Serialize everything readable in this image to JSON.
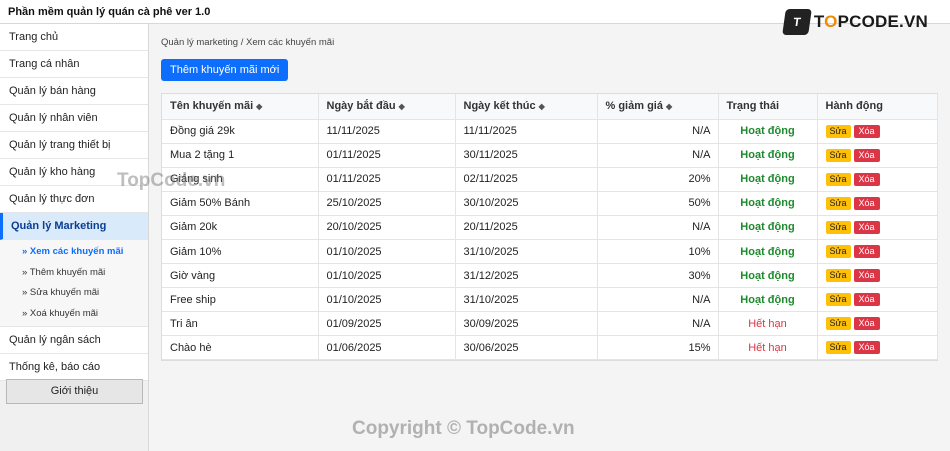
{
  "app": {
    "title": "Phần mềm quản lý quán cà phê ver 1.0"
  },
  "logo": {
    "mark": "T",
    "brand_pre": "T",
    "brand_o": "O",
    "brand_post": "PCODE.VN"
  },
  "sidebar": {
    "items_top": [
      {
        "label": "Trang chủ"
      },
      {
        "label": "Trang cá nhân"
      },
      {
        "label": "Quản lý bán hàng"
      },
      {
        "label": "Quản lý nhân viên"
      },
      {
        "label": "Quản lý trang thiết bị"
      },
      {
        "label": "Quản lý kho hàng"
      },
      {
        "label": "Quản lý thực đơn"
      }
    ],
    "active": {
      "label": "Quản lý Marketing"
    },
    "subitems": [
      {
        "label": "» Xem các khuyến mãi"
      },
      {
        "label": "» Thêm khuyến mãi"
      },
      {
        "label": "» Sửa khuyến mãi"
      },
      {
        "label": "» Xoá khuyến mãi"
      }
    ],
    "items_bottom": [
      {
        "label": "Quản lý ngân sách"
      },
      {
        "label": "Thống kê, báo cáo"
      }
    ],
    "intro_button": "Giới thiệu"
  },
  "main": {
    "breadcrumb": "Quản lý marketing / Xem các khuyến mãi",
    "add_button": "Thêm khuyến mãi mới",
    "sort_icon": "◆",
    "columns": [
      "Tên khuyến mãi",
      "Ngày bắt đầu",
      "Ngày kết thúc",
      "% giảm giá",
      "Trạng thái",
      "Hành động"
    ],
    "edit_label": "Sửa",
    "delete_label": "Xóa",
    "rows": [
      {
        "name": "Đồng giá 29k",
        "start": "11/11/2025",
        "end": "11/11/2025",
        "discount": "N/A",
        "status": "Hoạt động"
      },
      {
        "name": "Mua 2 tặng 1",
        "start": "01/11/2025",
        "end": "30/11/2025",
        "discount": "N/A",
        "status": "Hoạt động"
      },
      {
        "name": "Giáng sinh",
        "start": "01/11/2025",
        "end": "02/11/2025",
        "discount": "20%",
        "status": "Hoạt động"
      },
      {
        "name": "Giảm 50% Bánh",
        "start": "25/10/2025",
        "end": "30/10/2025",
        "discount": "50%",
        "status": "Hoạt động"
      },
      {
        "name": "Giảm 20k",
        "start": "20/10/2025",
        "end": "20/11/2025",
        "discount": "N/A",
        "status": "Hoạt động"
      },
      {
        "name": "Giảm 10%",
        "start": "01/10/2025",
        "end": "31/10/2025",
        "discount": "10%",
        "status": "Hoạt động"
      },
      {
        "name": "Giờ vàng",
        "start": "01/10/2025",
        "end": "31/12/2025",
        "discount": "30%",
        "status": "Hoạt động"
      },
      {
        "name": "Free ship",
        "start": "01/10/2025",
        "end": "31/10/2025",
        "discount": "N/A",
        "status": "Hoạt động"
      },
      {
        "name": "Tri ân",
        "start": "01/09/2025",
        "end": "30/09/2025",
        "discount": "N/A",
        "status": "Hết hạn"
      },
      {
        "name": "Chào hè",
        "start": "01/06/2025",
        "end": "30/06/2025",
        "discount": "15%",
        "status": "Hết hạn"
      }
    ]
  },
  "watermarks": {
    "mid": "TopCode.vn",
    "bottom": "Copyright © TopCode.vn"
  },
  "colors": {
    "primary": "#0d6efd",
    "active_status": "#1e8a2e",
    "expired_status": "#dc3545",
    "edit": "#ffc107",
    "delete": "#dc3545"
  }
}
